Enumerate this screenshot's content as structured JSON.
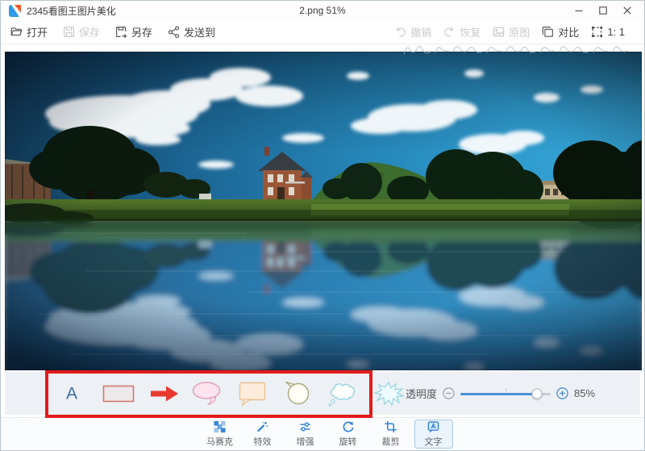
{
  "window": {
    "app_title": "2345看图王图片美化",
    "document_label": "2.png 51%"
  },
  "toolbar": {
    "open": "打开",
    "save": "保存",
    "save_as": "另存",
    "send_to": "发送到",
    "undo": "撤销",
    "redo": "恢复",
    "original": "原图",
    "compare": "对比",
    "actual_size": "1: 1"
  },
  "text_panel": {
    "text_tool_label": "A",
    "tools": [
      "text",
      "rectangle",
      "arrow",
      "ellipse-bubble",
      "square-bubble",
      "round-bubble",
      "cloud-bubble",
      "burst-bubble"
    ],
    "opacity": {
      "label": "透明度",
      "value": "85%",
      "percent": 85
    }
  },
  "annotation": {
    "type": "highlight-rectangle",
    "color": "#e31b1b"
  },
  "tabs": [
    {
      "label": "马赛克",
      "selected": false
    },
    {
      "label": "特效",
      "selected": false
    },
    {
      "label": "增强",
      "selected": false
    },
    {
      "label": "旋转",
      "selected": false
    },
    {
      "label": "裁剪",
      "selected": false
    },
    {
      "label": "文字",
      "selected": true
    }
  ],
  "colors": {
    "accent": "#2e81d6",
    "annotation_red": "#e31b1b",
    "slider_blue": "#4a90d9"
  }
}
